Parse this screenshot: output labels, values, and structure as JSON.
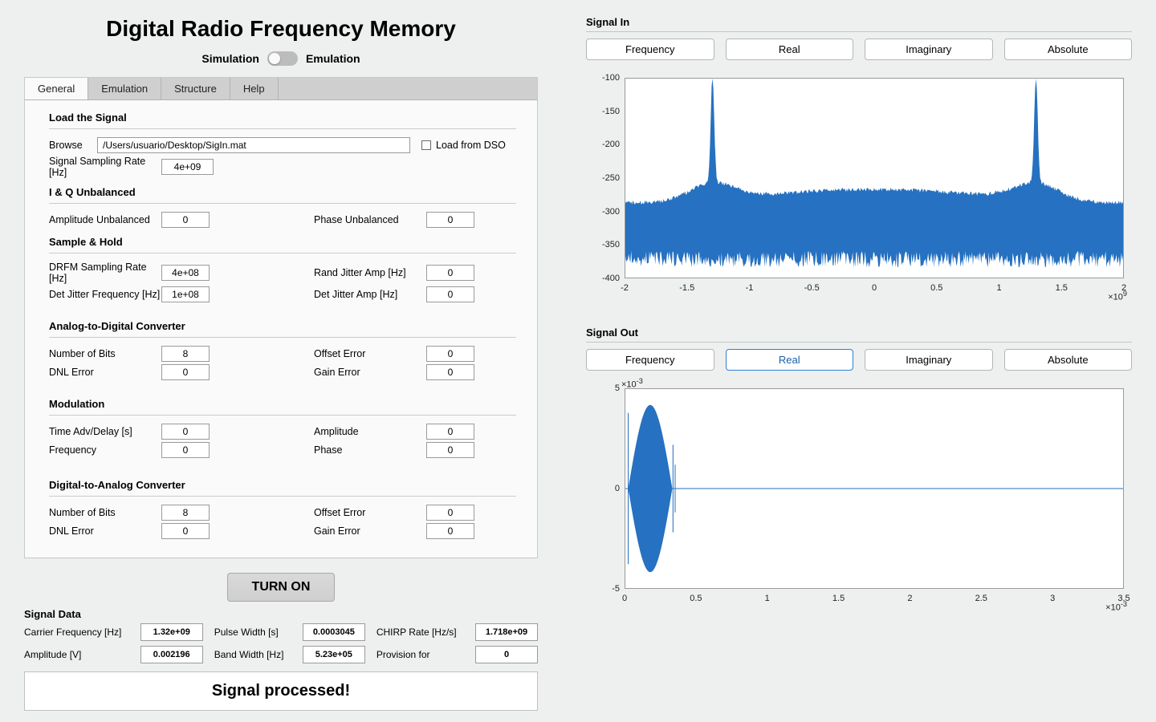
{
  "title": "Digital Radio Frequency Memory",
  "mode": {
    "left": "Simulation",
    "right": "Emulation"
  },
  "tabs": [
    "General",
    "Emulation",
    "Structure",
    "Help"
  ],
  "sections": {
    "load": {
      "title": "Load the Signal",
      "browse_label": "Browse",
      "path": "/Users/usuario/Desktop/SigIn.mat",
      "load_dso": "Load from DSO",
      "srate_label": "Signal Sampling Rate [Hz]",
      "srate": "4e+09"
    },
    "iq": {
      "title": "I & Q Unbalanced",
      "amp_label": "Amplitude Unbalanced",
      "amp": "0",
      "phase_label": "Phase Unbalanced",
      "phase": "0"
    },
    "sh": {
      "title": "Sample & Hold",
      "dsr_label": "DRFM Sampling Rate [Hz]",
      "dsr": "4e+08",
      "rja_label": "Rand Jitter Amp [Hz]",
      "rja": "0",
      "djf_label": "Det Jitter Frequency [Hz]",
      "djf": "1e+08",
      "dja_label": "Det Jitter Amp [Hz]",
      "dja": "0"
    },
    "adc": {
      "title": "Analog-to-Digital Converter",
      "bits_label": "Number of Bits",
      "bits": "8",
      "off_label": "Offset Error",
      "off": "0",
      "dnl_label": "DNL Error",
      "dnl": "0",
      "gain_label": "Gain Error",
      "gain": "0"
    },
    "mod": {
      "title": "Modulation",
      "time_label": "Time Adv/Delay [s]",
      "time": "0",
      "amp_label": "Amplitude",
      "amp": "0",
      "freq_label": "Frequency",
      "freq": "0",
      "phase_label": "Phase",
      "phase": "0"
    },
    "dac": {
      "title": "Digital-to-Analog Converter",
      "bits_label": "Number of Bits",
      "bits": "8",
      "off_label": "Offset Error",
      "off": "0",
      "dnl_label": "DNL Error",
      "dnl": "0",
      "gain_label": "Gain Error",
      "gain": "0"
    }
  },
  "turn_on": "TURN ON",
  "signal_data": {
    "title": "Signal Data",
    "rows": [
      [
        "Carrier Frequency [Hz]",
        "1.32e+09",
        "Pulse Width [s]",
        "0.0003045",
        "CHIRP Rate [Hz/s]",
        "1.718e+09"
      ],
      [
        "Amplitude [V]",
        "0.002196",
        "Band Width [Hz]",
        "5.23e+05",
        "Provision for",
        "0"
      ]
    ]
  },
  "status": "Signal processed!",
  "signal_in": {
    "title": "Signal In",
    "buttons": [
      "Frequency",
      "Real",
      "Imaginary",
      "Absolute"
    ],
    "selected": 0
  },
  "signal_out": {
    "title": "Signal Out",
    "buttons": [
      "Frequency",
      "Real",
      "Imaginary",
      "Absolute"
    ],
    "selected": 1
  },
  "chart_data": [
    {
      "type": "line",
      "title": "Signal In",
      "xlabel": "",
      "ylabel": "",
      "xlim": [
        -2,
        2
      ],
      "ylim": [
        -400,
        -100
      ],
      "x_mult": "×10^9",
      "xticks": [
        -2,
        -1.5,
        -1,
        -0.5,
        0,
        0.5,
        1,
        1.5,
        2
      ],
      "yticks": [
        -100,
        -150,
        -200,
        -250,
        -300,
        -350,
        -400
      ],
      "note": "Frequency-domain magnitude (dB). Dense noise floor ~ -360..-285 with two sharp peaks near x≈-1.3 and x≈1.3 reaching ~ -120.",
      "peaks_x": [
        -1.3,
        1.3
      ],
      "floor_top": -280,
      "floor_bot": -375,
      "peak_top": -120
    },
    {
      "type": "line",
      "title": "Signal Out",
      "xlabel": "",
      "ylabel": "",
      "xlim": [
        0,
        3.5
      ],
      "ylim": [
        -5,
        5
      ],
      "x_mult": "×10^-3",
      "y_mult": "×10^-3",
      "xticks": [
        0,
        0.5,
        1,
        1.5,
        2,
        2.5,
        3,
        3.5
      ],
      "yticks": [
        -5,
        0,
        5
      ],
      "note": "Time-domain real part: dense chirp envelope from x≈0.02 to x≈0.33 with amplitude ≈ ±4.2, then ≈0 afterwards.",
      "burst_start": 0.02,
      "burst_end": 0.33,
      "burst_amp": 4.2
    }
  ]
}
